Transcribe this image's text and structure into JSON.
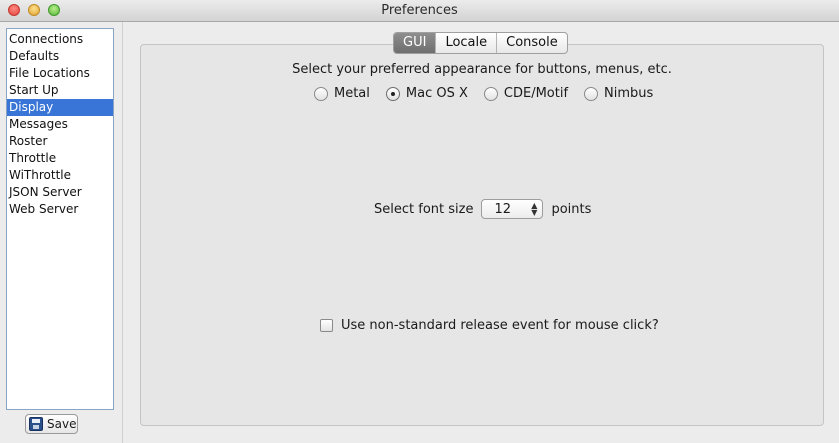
{
  "window": {
    "title": "Preferences"
  },
  "sidebar": {
    "items": [
      {
        "label": "Connections",
        "selected": false
      },
      {
        "label": "Defaults",
        "selected": false
      },
      {
        "label": "File Locations",
        "selected": false
      },
      {
        "label": "Start Up",
        "selected": false
      },
      {
        "label": "Display",
        "selected": true
      },
      {
        "label": "Messages",
        "selected": false
      },
      {
        "label": "Roster",
        "selected": false
      },
      {
        "label": "Throttle",
        "selected": false
      },
      {
        "label": "WiThrottle",
        "selected": false
      },
      {
        "label": "JSON Server",
        "selected": false
      },
      {
        "label": "Web Server",
        "selected": false
      }
    ],
    "save_label": "Save"
  },
  "tabs": [
    {
      "label": "GUI",
      "active": true
    },
    {
      "label": "Locale",
      "active": false
    },
    {
      "label": "Console",
      "active": false
    }
  ],
  "gui": {
    "appearance_label": "Select your preferred appearance for buttons, menus, etc.",
    "options": [
      {
        "label": "Metal",
        "checked": false
      },
      {
        "label": "Mac OS X",
        "checked": true
      },
      {
        "label": "CDE/Motif",
        "checked": false
      },
      {
        "label": "Nimbus",
        "checked": false
      }
    ],
    "font_size_label": "Select font size",
    "font_size_value": "12",
    "font_size_unit": "points",
    "release_event_label": "Use non-standard release event for mouse click?",
    "release_event_checked": false
  },
  "colors": {
    "selection": "#3875d7",
    "active_tab": "#7e7e7e"
  }
}
